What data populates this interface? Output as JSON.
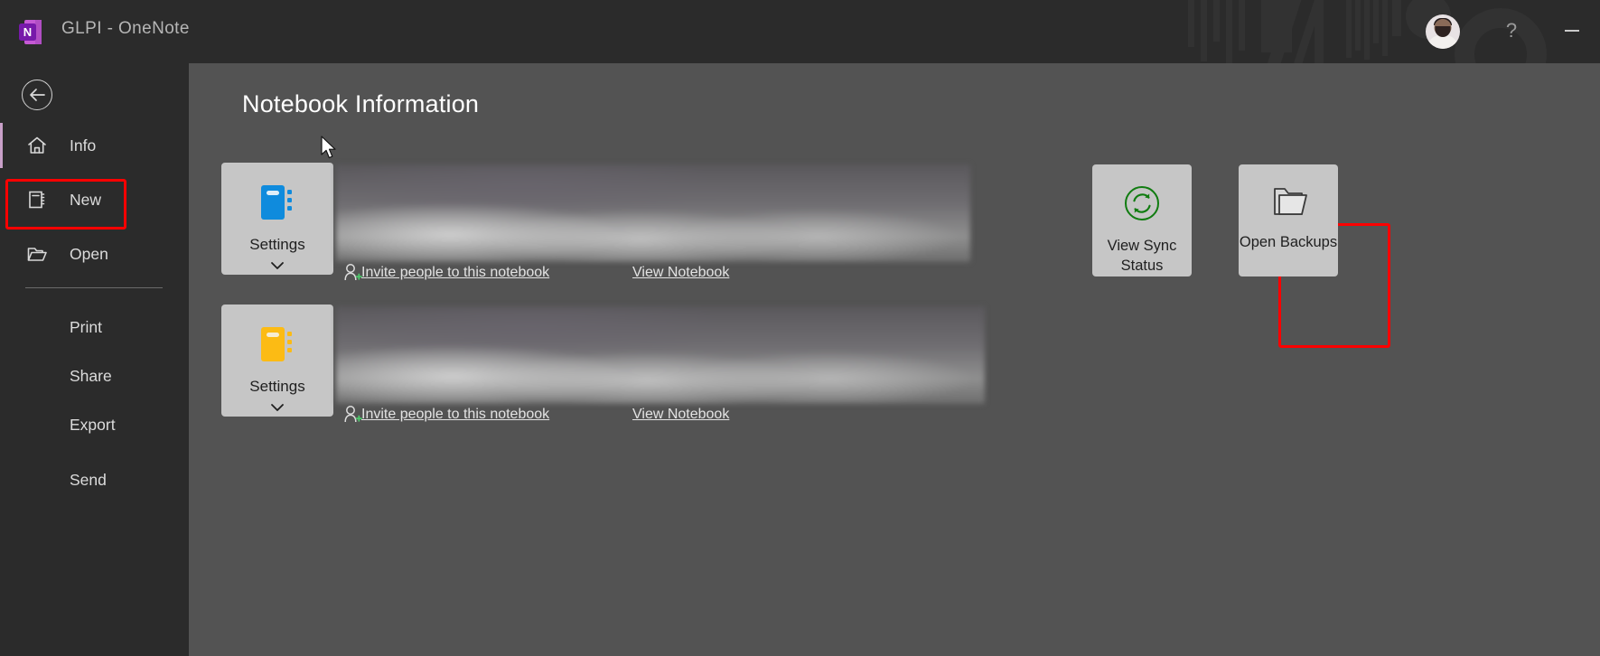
{
  "window": {
    "app_logo_icon": "onenote-logo-icon",
    "title": "GLPI  -  OneNote",
    "help_icon": "help-question-icon",
    "help_label": "?",
    "minimize_icon": "minimize-icon",
    "avatar_icon": "user-avatar"
  },
  "sidebar": {
    "back_icon": "back-arrow-icon",
    "items": [
      {
        "label": "Info",
        "icon": "home-icon",
        "selected": true
      },
      {
        "label": "New",
        "icon": "notebook-icon",
        "selected": false
      },
      {
        "label": "Open",
        "icon": "open-folder-icon",
        "selected": false
      },
      {
        "label": "Print",
        "icon": "",
        "selected": false
      },
      {
        "label": "Share",
        "icon": "",
        "selected": false
      },
      {
        "label": "Export",
        "icon": "",
        "selected": false
      },
      {
        "label": "Send",
        "icon": "",
        "selected": false
      }
    ]
  },
  "main": {
    "page_title": "Notebook Information",
    "notebooks": [
      {
        "settings_label": "Settings",
        "settings_chevron_icon": "chevron-down-icon",
        "notebook_icon": "notebook-icon",
        "notebook_color": "#0f8bdd",
        "name": "",
        "invite_icon": "person-add-icon",
        "invite_label": "Invite people to this notebook",
        "view_label": "View Notebook"
      },
      {
        "settings_label": "Settings",
        "settings_chevron_icon": "chevron-down-icon",
        "notebook_icon": "notebook-icon",
        "notebook_color": "#fcbb14",
        "name": "",
        "invite_icon": "person-add-icon",
        "invite_label": "Invite people to this notebook",
        "view_label": "View Notebook"
      }
    ],
    "actions": [
      {
        "label": "View Sync Status",
        "icon": "sync-status-icon",
        "icon_color": "#107c10",
        "highlighted": true
      },
      {
        "label": "Open Backups",
        "icon": "open-folder-icon",
        "icon_color": "#3a3a3a",
        "highlighted": false
      }
    ]
  },
  "colors": {
    "highlight": "#fe0000",
    "sidebar_bg": "#2b2b2b",
    "main_bg": "#535353",
    "tile_bg": "#c6c6c6",
    "accent_selected": "#c9a0c9"
  },
  "cursor": {
    "icon": "mouse-pointer-icon"
  }
}
